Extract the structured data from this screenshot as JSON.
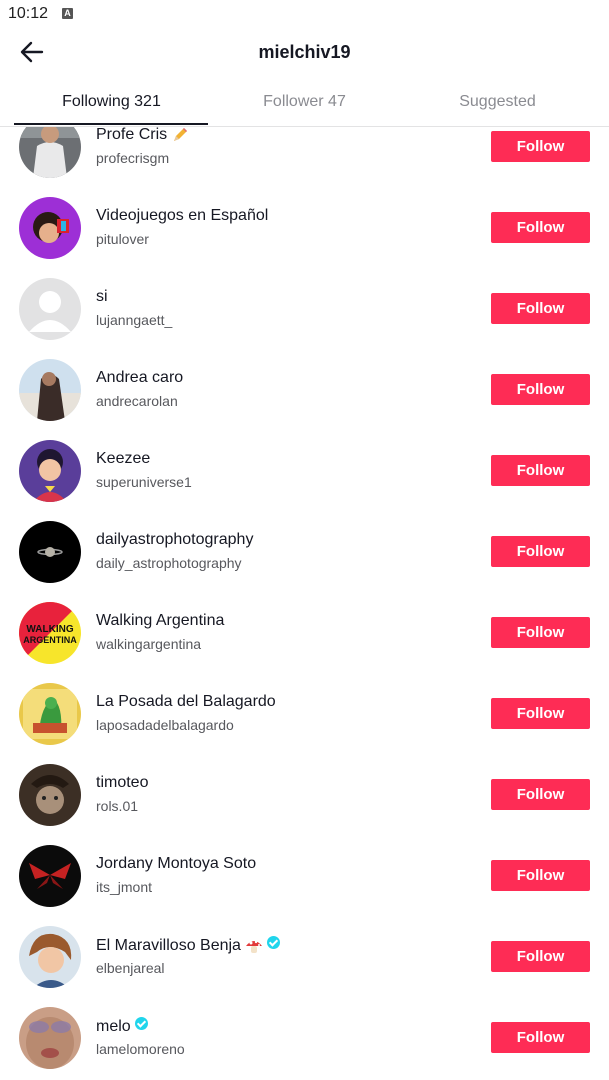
{
  "status": {
    "time": "10:12",
    "indicator": "A"
  },
  "header": {
    "title": "mielchiv19",
    "back_icon": "arrow-left-icon"
  },
  "tabs": [
    {
      "label": "Following 321",
      "active": true
    },
    {
      "label": "Follower 47",
      "active": false
    },
    {
      "label": "Suggested",
      "active": false
    }
  ],
  "colors": {
    "accent": "#fe2c55",
    "text": "#161823",
    "muted": "#8a8b91",
    "verified": "#20d5ec"
  },
  "users": [
    {
      "name": "Profe Cris",
      "handle": "profecrisgm",
      "follow": "Follow",
      "emoji": "pencil-icon",
      "verified": false
    },
    {
      "name": "Videojuegos en Español",
      "handle": "pitulover",
      "follow": "Follow",
      "verified": false
    },
    {
      "name": "si",
      "handle": "lujanngaett_",
      "follow": "Follow",
      "verified": false
    },
    {
      "name": "Andrea caro",
      "handle": "andrecarolan",
      "follow": "Follow",
      "verified": false
    },
    {
      "name": "Keezee",
      "handle": "superuniverse1",
      "follow": "Follow",
      "verified": false
    },
    {
      "name": "dailyastrophotography",
      "handle": "daily_astrophotography",
      "follow": "Follow",
      "verified": false
    },
    {
      "name": "Walking Argentina",
      "handle": "walkingargentina",
      "follow": "Follow",
      "verified": false
    },
    {
      "name": "La Posada del Balagardo",
      "handle": "laposadadelbalagardo",
      "follow": "Follow",
      "verified": false
    },
    {
      "name": "timoteo",
      "handle": "rols.01",
      "follow": "Follow",
      "verified": false
    },
    {
      "name": "Jordany Montoya Soto",
      "handle": "its_jmont",
      "follow": "Follow",
      "verified": false
    },
    {
      "name": "El Maravilloso Benja",
      "handle": "elbenjareal",
      "follow": "Follow",
      "emoji": "mushroom-icon",
      "verified": true
    },
    {
      "name": "melo",
      "handle": "lamelomoreno",
      "follow": "Follow",
      "verified": true
    }
  ]
}
